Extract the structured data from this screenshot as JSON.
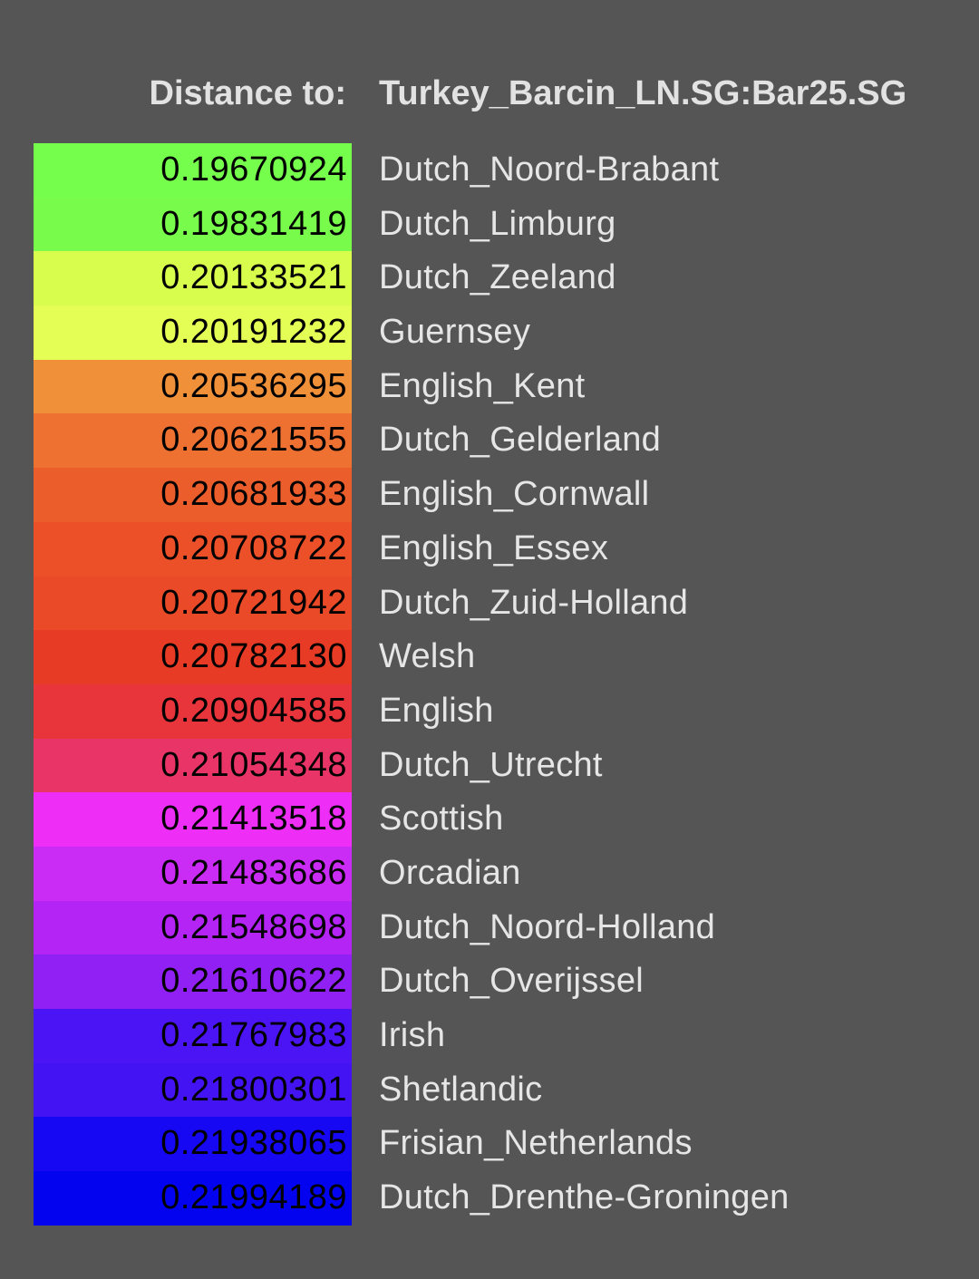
{
  "header": {
    "label": "Distance to:",
    "target": "Turkey_Barcin_LN.SG:Bar25.SG"
  },
  "rows": [
    {
      "value": "0.19670924",
      "name": "Dutch_Noord-Brabant",
      "color": "#76fe4c"
    },
    {
      "value": "0.19831419",
      "name": "Dutch_Limburg",
      "color": "#79fb4c"
    },
    {
      "value": "0.20133521",
      "name": "Dutch_Zeeland",
      "color": "#d9fd4d"
    },
    {
      "value": "0.20191232",
      "name": "Guernsey",
      "color": "#e5fe56"
    },
    {
      "value": "0.20536295",
      "name": "English_Kent",
      "color": "#f09039"
    },
    {
      "value": "0.20621555",
      "name": "Dutch_Gelderland",
      "color": "#ee7132"
    },
    {
      "value": "0.20681933",
      "name": "English_Cornwall",
      "color": "#ec5d2c"
    },
    {
      "value": "0.20708722",
      "name": "English_Essex",
      "color": "#eb5029"
    },
    {
      "value": "0.20721942",
      "name": "Dutch_Zuid-Holland",
      "color": "#ea4a27"
    },
    {
      "value": "0.20782130",
      "name": "Welsh",
      "color": "#e83b25"
    },
    {
      "value": "0.20904585",
      "name": "English",
      "color": "#e8343b"
    },
    {
      "value": "0.21054348",
      "name": "Dutch_Utrecht",
      "color": "#e83466"
    },
    {
      "value": "0.21413518",
      "name": "Scottish",
      "color": "#ee2ef6"
    },
    {
      "value": "0.21483686",
      "name": "Orcadian",
      "color": "#cb2cf5"
    },
    {
      "value": "0.21548698",
      "name": "Dutch_Noord-Holland",
      "color": "#b424f5"
    },
    {
      "value": "0.21610622",
      "name": "Dutch_Overijssel",
      "color": "#9120f5"
    },
    {
      "value": "0.21767983",
      "name": "Irish",
      "color": "#4b14f4"
    },
    {
      "value": "0.21800301",
      "name": "Shetlandic",
      "color": "#4313f4"
    },
    {
      "value": "0.21938065",
      "name": "Frisian_Netherlands",
      "color": "#1608f2"
    },
    {
      "value": "0.21994189",
      "name": "Dutch_Drenthe-Groningen",
      "color": "#0303ef"
    }
  ]
}
